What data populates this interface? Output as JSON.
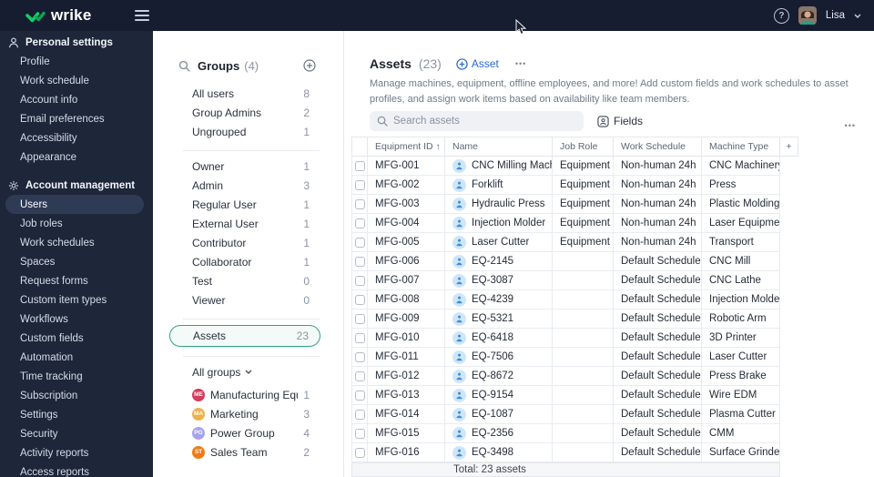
{
  "topbar": {
    "brand": "wrike",
    "user_name": "Lisa",
    "help_glyph": "?"
  },
  "colors": {
    "wrike_green": "#13ce66",
    "accent_blue": "#2966d4",
    "selected_green": "#2da383",
    "sidebar_bg": "#1e2639",
    "topbar_bg": "#161d31"
  },
  "sidebar": {
    "sections": [
      {
        "title": "Personal settings",
        "icon": "person-icon",
        "items": [
          {
            "label": "Profile"
          },
          {
            "label": "Work schedule"
          },
          {
            "label": "Account info"
          },
          {
            "label": "Email preferences"
          },
          {
            "label": "Accessibility"
          },
          {
            "label": "Appearance"
          }
        ]
      },
      {
        "title": "Account management",
        "icon": "gear-icon",
        "items": [
          {
            "label": "Users",
            "selected": true
          },
          {
            "label": "Job roles"
          },
          {
            "label": "Work schedules"
          },
          {
            "label": "Spaces"
          },
          {
            "label": "Request forms"
          },
          {
            "label": "Custom item types"
          },
          {
            "label": "Workflows"
          },
          {
            "label": "Custom fields"
          },
          {
            "label": "Automation"
          },
          {
            "label": "Time tracking"
          },
          {
            "label": "Subscription"
          },
          {
            "label": "Settings"
          },
          {
            "label": "Security"
          },
          {
            "label": "Activity reports"
          },
          {
            "label": "Access reports"
          }
        ]
      }
    ]
  },
  "groups_panel": {
    "title": "Groups",
    "count": "(4)",
    "sections": [
      {
        "items": [
          {
            "label": "All users",
            "count": "8"
          },
          {
            "label": "Group Admins",
            "count": "2"
          },
          {
            "label": "Ungrouped",
            "count": "1"
          }
        ]
      },
      {
        "items": [
          {
            "label": "Owner",
            "count": "1"
          },
          {
            "label": "Admin",
            "count": "3"
          },
          {
            "label": "Regular User",
            "count": "1"
          },
          {
            "label": "External User",
            "count": "1"
          },
          {
            "label": "Contributor",
            "count": "1"
          },
          {
            "label": "Collaborator",
            "count": "1"
          },
          {
            "label": "Test",
            "count": "0"
          },
          {
            "label": "Viewer",
            "count": "0"
          }
        ]
      },
      {
        "items": [
          {
            "label": "Assets",
            "count": "23",
            "selected": true
          }
        ]
      }
    ],
    "all_groups_label": "All groups",
    "teams": [
      {
        "initials": "ME",
        "label": "Manufacturing Equipm...",
        "count": "1",
        "color": "#d63c5e"
      },
      {
        "initials": "MA",
        "label": "Marketing",
        "count": "3",
        "color": "#edb14d"
      },
      {
        "initials": "PG",
        "label": "Power Group",
        "count": "4",
        "color": "#a5a4ec"
      },
      {
        "initials": "ST",
        "label": "Sales Team",
        "count": "2",
        "color": "#ee7b17"
      }
    ]
  },
  "assets_panel": {
    "title": "Assets",
    "count": "(23)",
    "add_button_label": "Asset",
    "more_glyph": "•••",
    "description": "Manage machines, equipment, offline employees, and more! Add custom fields and work schedules to asset profiles, and assign work items based on availability like team members.",
    "search_placeholder": "Search assets",
    "fields_button_label": "Fields",
    "table": {
      "columns": [
        "Equipment ID",
        "Name",
        "Job Role",
        "Work Schedule",
        "Machine Type"
      ],
      "sorted_column": "Equipment ID",
      "sort_glyph": "↑",
      "add_column_glyph": "+",
      "rows": [
        {
          "equipment_id": "MFG-001",
          "name": "CNC Milling Machi...",
          "job_role": "Equipment",
          "work_schedule": "Non-human 24h",
          "machine_type": "CNC Machinery"
        },
        {
          "equipment_id": "MFG-002",
          "name": "Forklift",
          "job_role": "Equipment",
          "work_schedule": "Non-human 24h",
          "machine_type": "Press"
        },
        {
          "equipment_id": "MFG-003",
          "name": "Hydraulic Press",
          "job_role": "Equipment",
          "work_schedule": "Non-human 24h",
          "machine_type": "Plastic Molding"
        },
        {
          "equipment_id": "MFG-004",
          "name": "Injection Molder",
          "job_role": "Equipment",
          "work_schedule": "Non-human 24h",
          "machine_type": "Laser Equipment"
        },
        {
          "equipment_id": "MFG-005",
          "name": "Laser Cutter",
          "job_role": "Equipment",
          "work_schedule": "Non-human 24h",
          "machine_type": "Transport"
        },
        {
          "equipment_id": "MFG-006",
          "name": "EQ-2145",
          "job_role": "",
          "work_schedule": "Default Schedule",
          "machine_type": "CNC Mill"
        },
        {
          "equipment_id": "MFG-007",
          "name": "EQ-3087",
          "job_role": "",
          "work_schedule": "Default Schedule",
          "machine_type": "CNC Lathe"
        },
        {
          "equipment_id": "MFG-008",
          "name": "EQ-4239",
          "job_role": "",
          "work_schedule": "Default Schedule",
          "machine_type": "Injection Molder"
        },
        {
          "equipment_id": "MFG-009",
          "name": "EQ-5321",
          "job_role": "",
          "work_schedule": "Default Schedule",
          "machine_type": "Robotic Arm"
        },
        {
          "equipment_id": "MFG-010",
          "name": "EQ-6418",
          "job_role": "",
          "work_schedule": "Default Schedule",
          "machine_type": "3D Printer"
        },
        {
          "equipment_id": "MFG-011",
          "name": "EQ-7506",
          "job_role": "",
          "work_schedule": "Default Schedule",
          "machine_type": "Laser Cutter"
        },
        {
          "equipment_id": "MFG-012",
          "name": "EQ-8672",
          "job_role": "",
          "work_schedule": "Default Schedule",
          "machine_type": "Press Brake"
        },
        {
          "equipment_id": "MFG-013",
          "name": "EQ-9154",
          "job_role": "",
          "work_schedule": "Default Schedule",
          "machine_type": "Wire EDM"
        },
        {
          "equipment_id": "MFG-014",
          "name": "EQ-1087",
          "job_role": "",
          "work_schedule": "Default Schedule",
          "machine_type": "Plasma Cutter"
        },
        {
          "equipment_id": "MFG-015",
          "name": "EQ-2356",
          "job_role": "",
          "work_schedule": "Default Schedule",
          "machine_type": "CMM"
        },
        {
          "equipment_id": "MFG-016",
          "name": "EQ-3498",
          "job_role": "",
          "work_schedule": "Default Schedule",
          "machine_type": "Surface Grinder"
        }
      ],
      "footer": "Total: 23 assets"
    }
  }
}
